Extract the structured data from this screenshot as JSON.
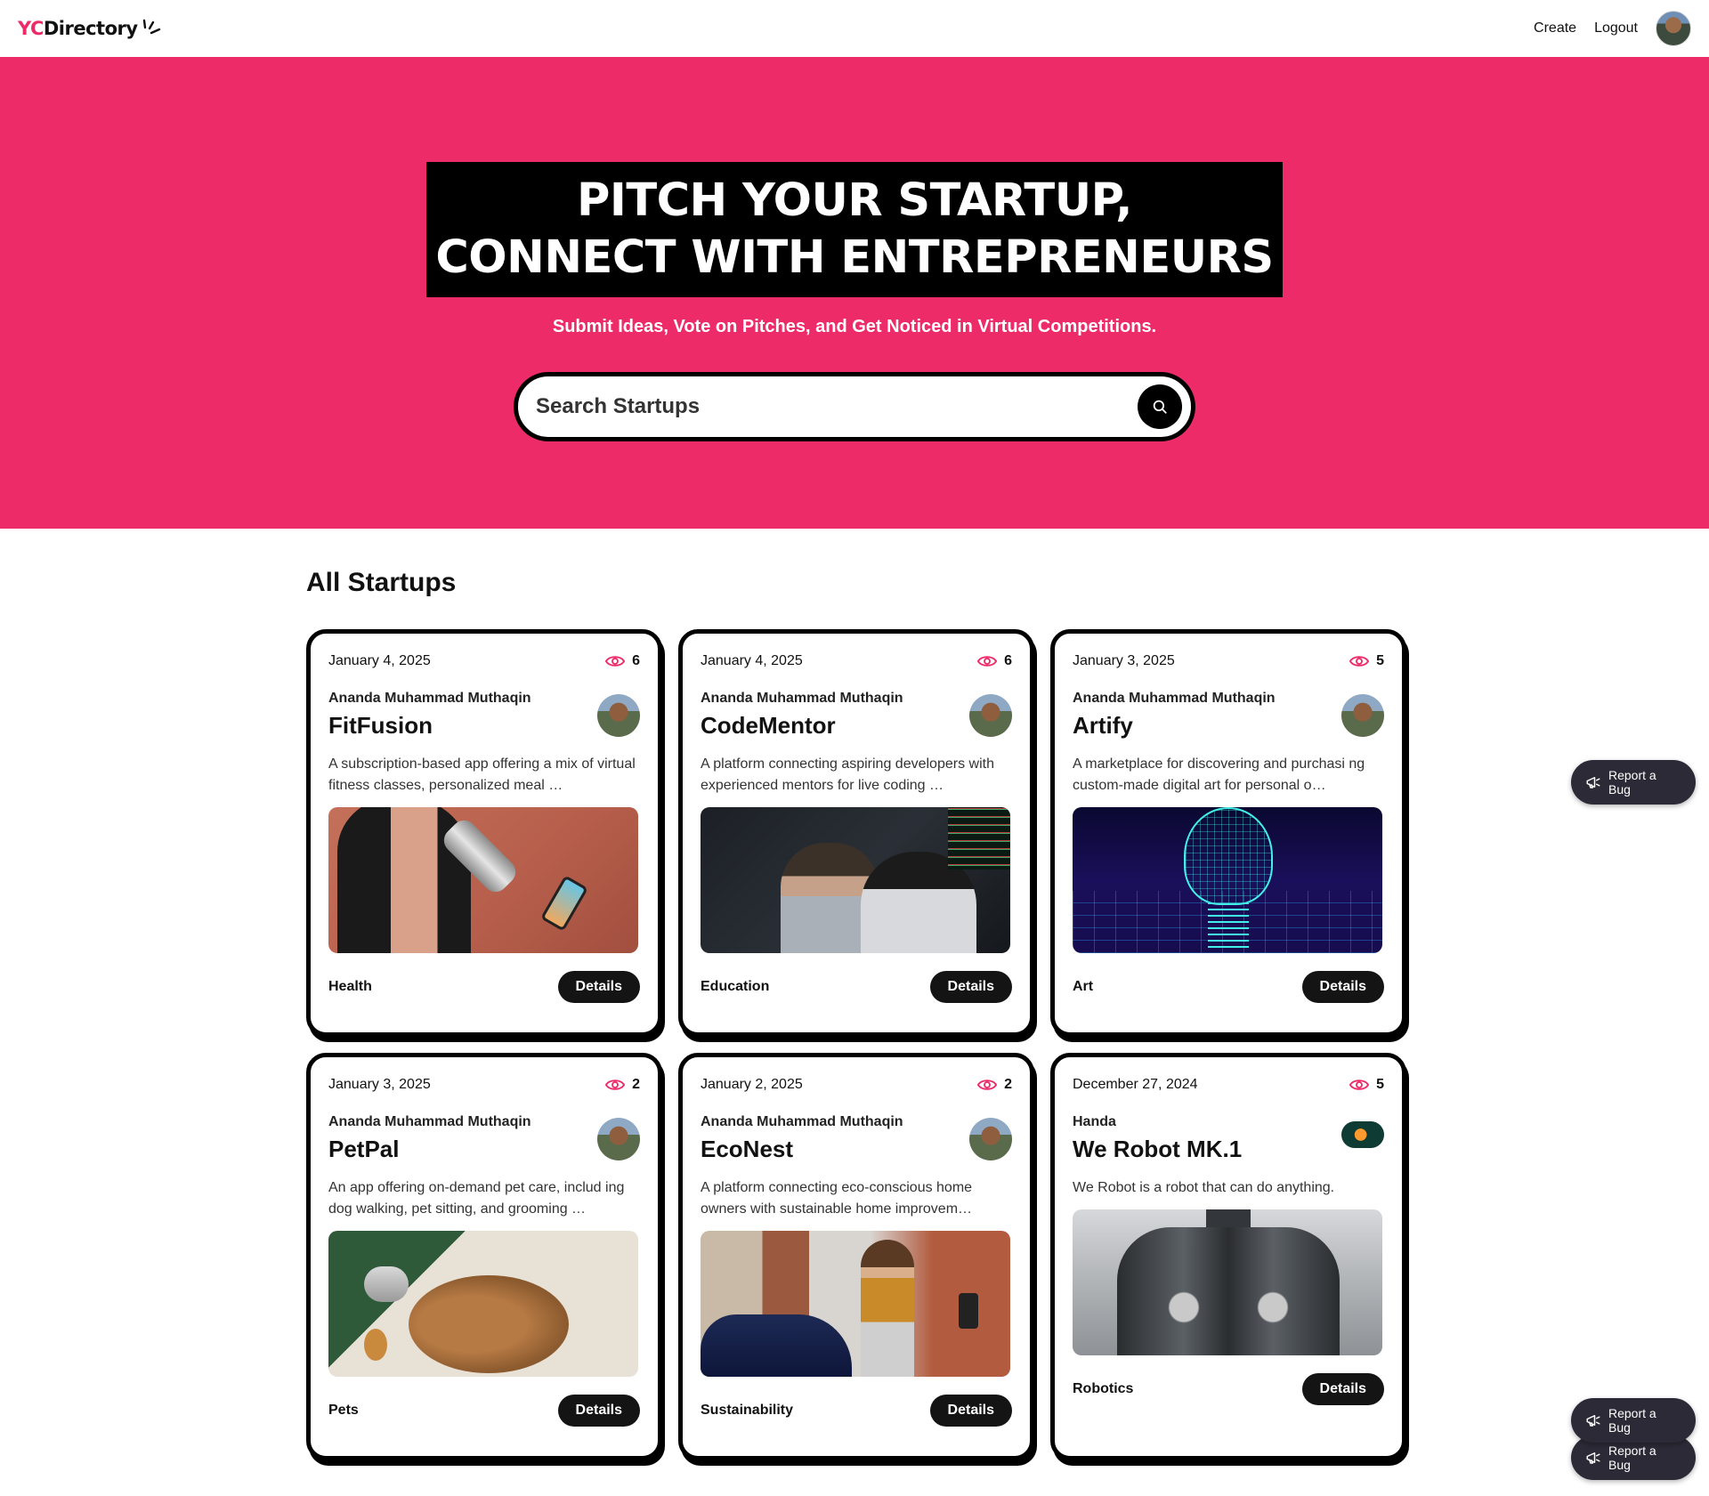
{
  "nav": {
    "logo_prefix": "YC",
    "logo_name": "Directory",
    "create": "Create",
    "logout": "Logout"
  },
  "hero": {
    "heading_line1": "Pitch your startup,",
    "heading_line2": "connect with entrepreneurs",
    "subheading": "Submit Ideas, Vote on Pitches, and Get Noticed in Virtual Competitions.",
    "search_placeholder": "Search Startups"
  },
  "section_title": "All Startups",
  "details_label": "Details",
  "cards": [
    {
      "date": "January 4, 2025",
      "views": "6",
      "author": "Ananda Muhammad Muthaqin",
      "title": "FitFusion",
      "description": "A subscription-based app offering a mix of virtual fitness classes, personalized meal …",
      "category": "Health"
    },
    {
      "date": "January 4, 2025",
      "views": "6",
      "author": "Ananda Muhammad Muthaqin",
      "title": "CodeMentor",
      "description": "A platform connecting aspiring developers with experienced mentors for live coding …",
      "category": "Education"
    },
    {
      "date": "January 3, 2025",
      "views": "5",
      "author": "Ananda Muhammad Muthaqin",
      "title": "Artify",
      "description": "A marketplace for discovering and purchasi ng custom-made digital art for personal o…",
      "category": "Art"
    },
    {
      "date": "January 3, 2025",
      "views": "2",
      "author": "Ananda Muhammad Muthaqin",
      "title": "PetPal",
      "description": "An app offering on-demand pet care, includ ing dog walking, pet sitting, and grooming …",
      "category": "Pets"
    },
    {
      "date": "January 2, 2025",
      "views": "2",
      "author": "Ananda Muhammad Muthaqin",
      "title": "EcoNest",
      "description": "A platform connecting eco-conscious home owners with sustainable home improvem…",
      "category": "Sustainability"
    },
    {
      "date": "December 27, 2024",
      "views": "5",
      "author": "Handa",
      "title": "We Robot MK.1",
      "description": "We Robot is a robot that can do anything.",
      "category": "Robotics"
    }
  ],
  "report_bug_label": "Report a Bug",
  "colors": {
    "accent": "#EE2B69",
    "black": "#000000",
    "button_dark": "#141414",
    "bug_button": "#2b2a36"
  },
  "icons": [
    "spark-icon",
    "search-icon",
    "eye-icon",
    "megaphone-icon"
  ]
}
